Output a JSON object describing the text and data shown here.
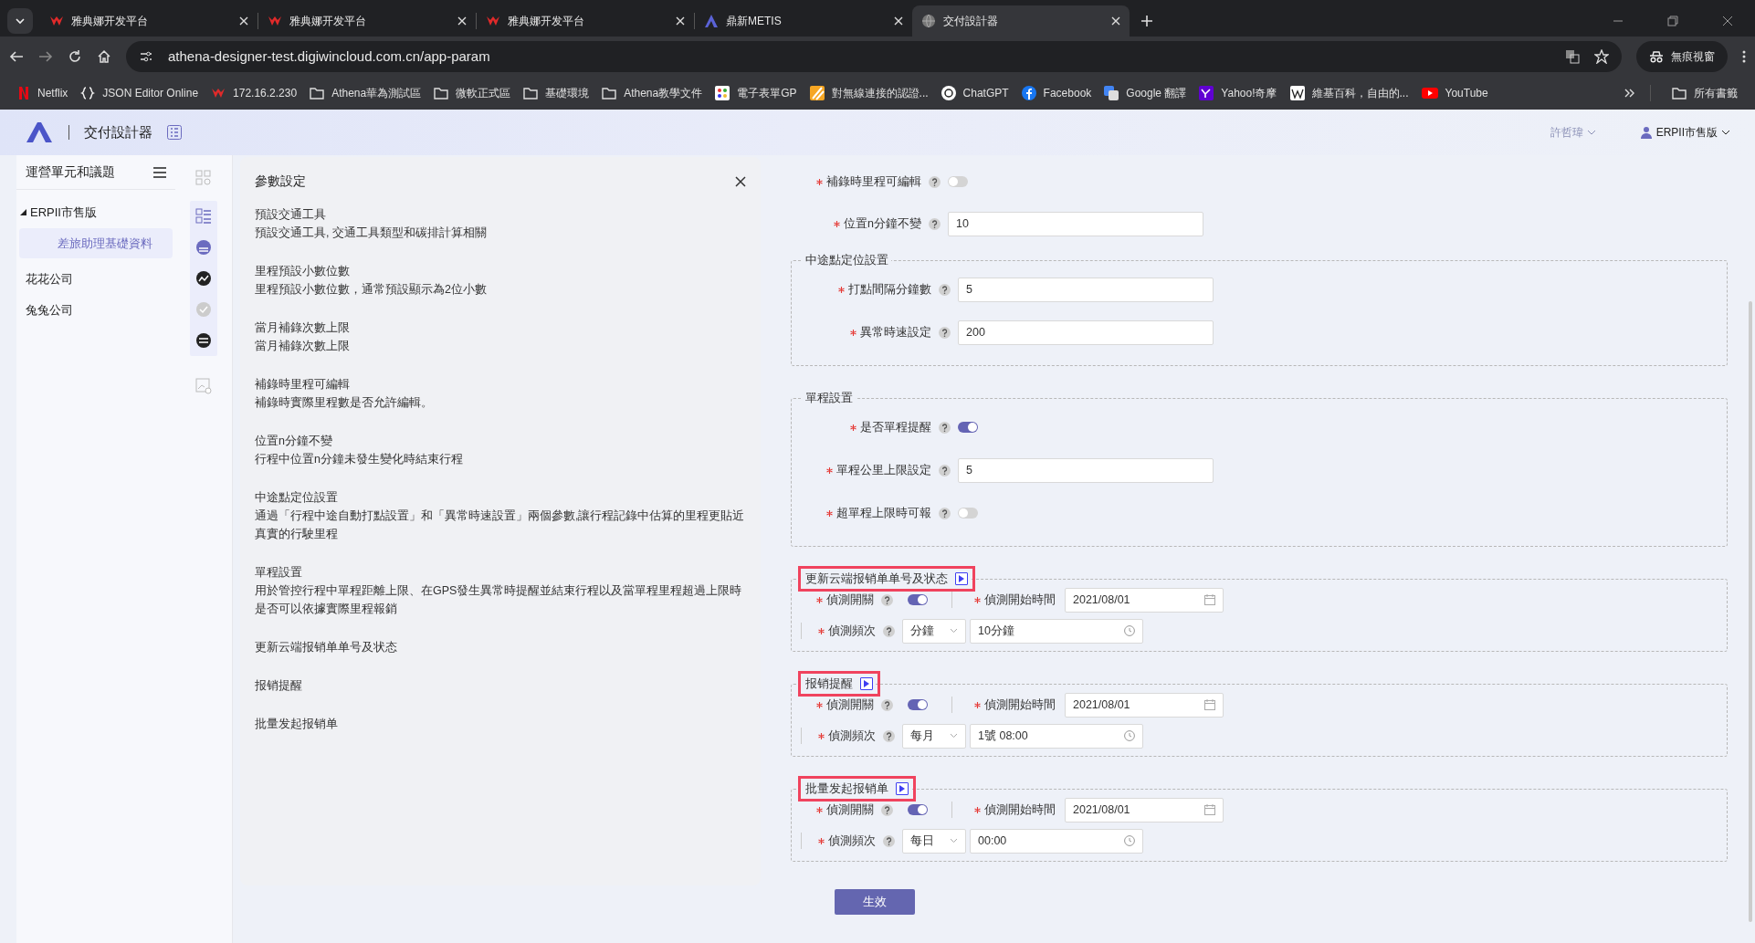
{
  "browser": {
    "tabs": [
      {
        "title": "雅典娜开发平台",
        "kind": "athena",
        "selected": false
      },
      {
        "title": "雅典娜开发平台",
        "kind": "athena",
        "selected": false
      },
      {
        "title": "雅典娜开发平台",
        "kind": "athena",
        "selected": false
      },
      {
        "title": "鼎新METIS",
        "kind": "metis",
        "selected": false
      },
      {
        "title": "交付設計器",
        "kind": "globe",
        "selected": true
      }
    ],
    "address": "athena-designer-test.digiwincloud.com.cn/app-param",
    "profile": "無痕視窗",
    "bookmarks": [
      {
        "label": "Netflix",
        "kind": "netflix"
      },
      {
        "label": "JSON Editor Online",
        "kind": "braces"
      },
      {
        "label": "172.16.2.230",
        "kind": "athena"
      },
      {
        "label": "Athena華為測試區",
        "kind": "folder"
      },
      {
        "label": "微軟正式區",
        "kind": "folder"
      },
      {
        "label": "基礎環境",
        "kind": "folder"
      },
      {
        "label": "Athena教學文件",
        "kind": "folder"
      },
      {
        "label": "電子表單GP",
        "kind": "dots"
      },
      {
        "label": "對無線連接的認證...",
        "kind": "stripes"
      },
      {
        "label": "ChatGPT",
        "kind": "chatgpt"
      },
      {
        "label": "Facebook",
        "kind": "facebook"
      },
      {
        "label": "Google 翻譯",
        "kind": "translate"
      },
      {
        "label": "Yahoo!奇摩",
        "kind": "yahoo"
      },
      {
        "label": "維基百科，自由的...",
        "kind": "wiki"
      },
      {
        "label": "YouTube",
        "kind": "youtube"
      }
    ],
    "all_bookmarks": "所有書籤"
  },
  "app": {
    "title": "交付設計器",
    "user": "許哲瑋",
    "tenant": "ERPII市售版"
  },
  "sidebar": {
    "title": "運營單元和議題",
    "tree": [
      {
        "label": "ERPII市售版",
        "expanded": true,
        "selected": false,
        "children": [
          {
            "label": "差旅助理基礎資料",
            "selected": true
          }
        ]
      },
      {
        "label": "花花公司",
        "selected": false
      },
      {
        "label": "兔兔公司",
        "selected": false
      }
    ]
  },
  "panel": {
    "title": "參數設定",
    "items": [
      {
        "title": "預設交通工具",
        "desc": "預設交通工具, 交通工具類型和碳排計算相關"
      },
      {
        "title": "里程預設小數位數",
        "desc": "里程預設小數位數，通常預設顯示為2位小數"
      },
      {
        "title": "當月補錄次數上限",
        "desc": "當月補錄次數上限"
      },
      {
        "title": "補錄時里程可編輯",
        "desc": "補錄時實際里程數是否允許編輯。"
      },
      {
        "title": "位置n分鐘不變",
        "desc": "行程中位置n分鐘未發生變化時結束行程"
      },
      {
        "title": "中途點定位設置",
        "desc": "通過「行程中途自動打點設置」和「異常時速設置」兩個參數,讓行程記錄中估算的里程更貼近真實的行駛里程"
      },
      {
        "title": "單程設置",
        "desc": "用於管控行程中單程距離上限、在GPS發生異常時提醒並結束行程以及當單程里程超過上限時是否可以依據實際里程報銷"
      },
      {
        "title": "更新云端报销单单号及状态"
      },
      {
        "title": "报销提醒"
      },
      {
        "title": "批量发起报销单"
      }
    ]
  },
  "form": {
    "items": [
      {
        "kind": "toggle",
        "label": "補錄時里程可編輯",
        "required": true,
        "on": false
      },
      {
        "kind": "input",
        "label": "位置n分鐘不變",
        "required": true,
        "value": "10"
      },
      {
        "kind": "group",
        "legend": "中途點定位設置",
        "items": [
          {
            "kind": "input",
            "label": "打點間隔分鐘數",
            "required": true,
            "value": "5"
          },
          {
            "kind": "input",
            "label": "異常時速設定",
            "required": true,
            "value": "200"
          }
        ]
      },
      {
        "kind": "group",
        "legend": "單程設置",
        "items": [
          {
            "kind": "toggle",
            "label": "是否單程提醒",
            "required": true,
            "on": true
          },
          {
            "kind": "input",
            "label": "單程公里上限設定",
            "required": true,
            "value": "5"
          },
          {
            "kind": "toggle",
            "label": "超單程上限時可報",
            "required": true,
            "on": false
          }
        ]
      },
      {
        "kind": "schedule",
        "legend": "更新云端报销单单号及状态",
        "highlighted": true,
        "switch_label": "偵測開關",
        "on": true,
        "start_label": "偵測開始時間",
        "start_date": "2021/08/01",
        "freq_label": "偵測頻次",
        "freq_unit": "分鐘",
        "freq_value": "10分鐘"
      },
      {
        "kind": "schedule",
        "legend": "报销提醒",
        "highlighted": true,
        "switch_label": "偵測開關",
        "on": true,
        "start_label": "偵測開始時間",
        "start_date": "2021/08/01",
        "freq_label": "偵測頻次",
        "freq_unit": "每月",
        "freq_value": "1號 08:00"
      },
      {
        "kind": "schedule",
        "legend": "批量发起报销单",
        "highlighted": true,
        "switch_label": "偵測開關",
        "on": true,
        "start_label": "偵測開始時間",
        "start_date": "2021/08/01",
        "freq_label": "偵測頻次",
        "freq_unit": "每日",
        "freq_value": "00:00"
      }
    ],
    "submit": "生效"
  }
}
